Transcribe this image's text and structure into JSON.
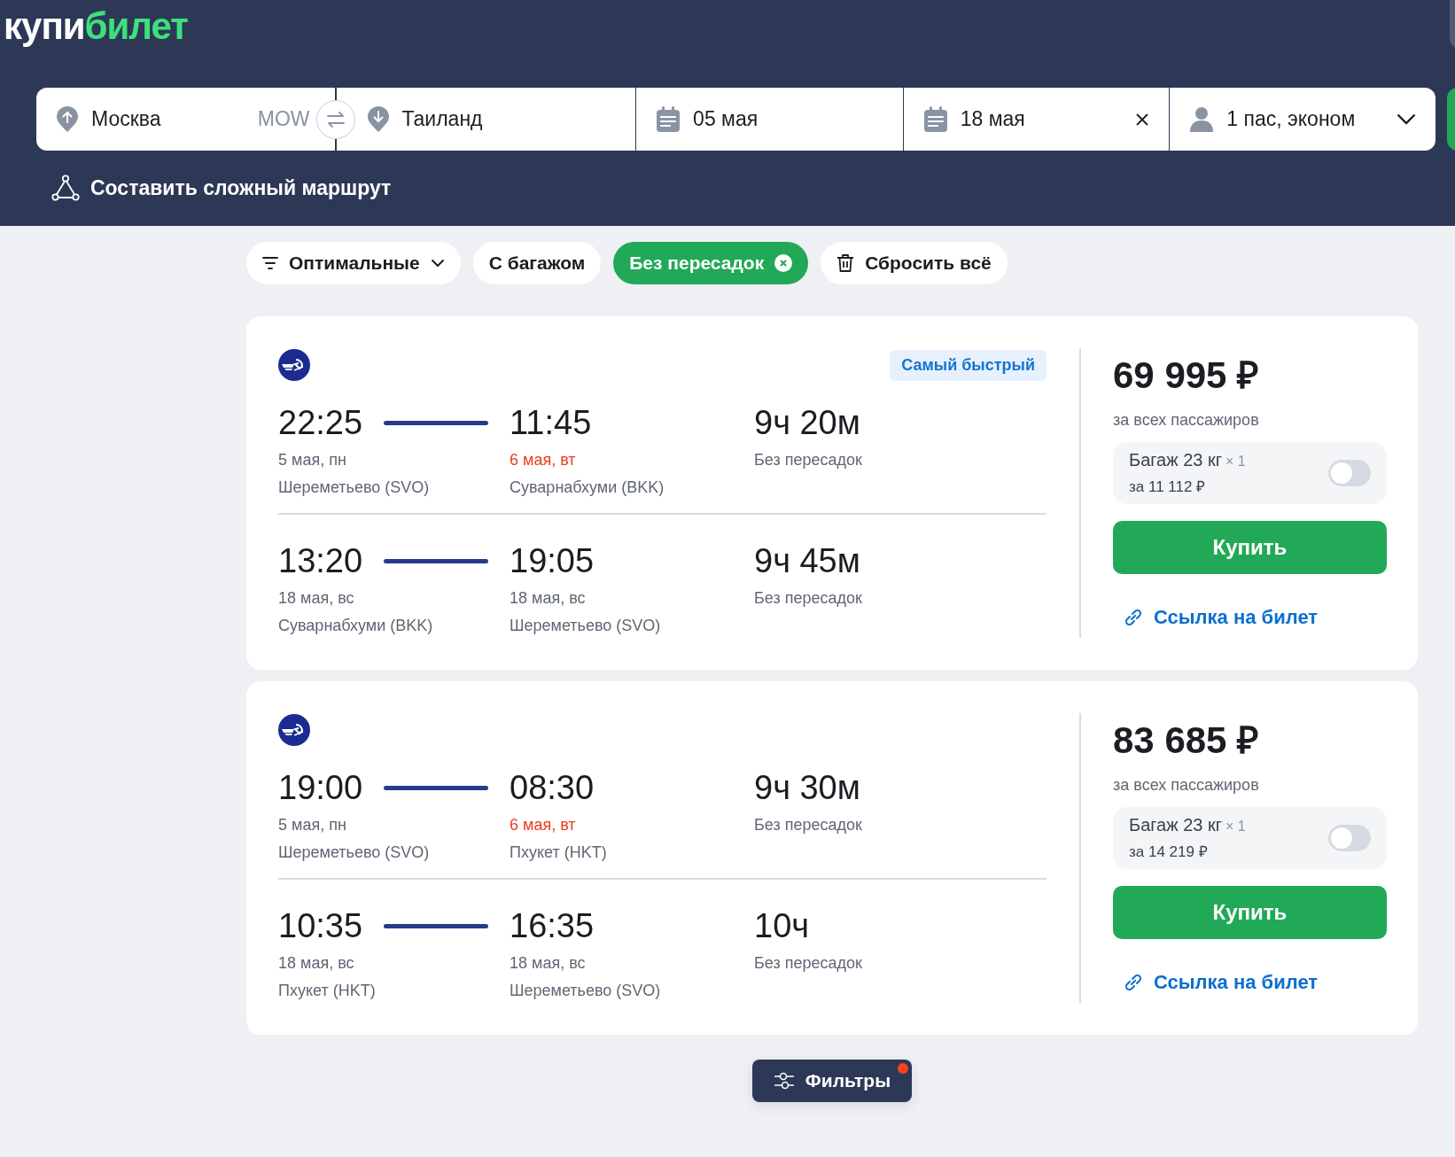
{
  "logo": {
    "first": "купи",
    "second": "билет"
  },
  "search": {
    "from": {
      "city": "Москва",
      "code": "MOW"
    },
    "to": {
      "city": "Таиланд"
    },
    "depart": "05 мая",
    "return": "18 мая",
    "passengers": "1 пас, эконом"
  },
  "complex_route": "Составить сложный маршрут",
  "chips": [
    {
      "kind": "sort",
      "label": "Оптимальные",
      "selected": false
    },
    {
      "kind": "chip",
      "label": "С багажом",
      "selected": false
    },
    {
      "kind": "chip",
      "label": "Без пересадок",
      "selected": true
    },
    {
      "kind": "reset",
      "label": "Сбросить всё",
      "selected": false
    }
  ],
  "tickets": [
    {
      "badge": "Самый быстрый",
      "price": "69 995 ₽",
      "price_note": "за всех пассажиров",
      "baggage": {
        "label": "Багаж 23 кг",
        "qty": "× 1",
        "price": "за 11 112 ₽",
        "on": false
      },
      "buy": "Купить",
      "link": "Ссылка на билет",
      "segments": [
        {
          "dep_time": "22:25",
          "dep_date": "5 мая, пн",
          "dep_airport": "Шереметьево (SVO)",
          "arr_time": "11:45",
          "arr_date": "6 мая, вт",
          "next_day": true,
          "arr_airport": "Суварнабхуми (BKK)",
          "duration": "9ч 20м",
          "stops": "Без пересадок"
        },
        {
          "dep_time": "13:20",
          "dep_date": "18 мая, вс",
          "dep_airport": "Суварнабхуми (BKK)",
          "arr_time": "19:05",
          "arr_date": "18 мая, вс",
          "next_day": false,
          "arr_airport": "Шереметьево (SVO)",
          "duration": "9ч 45м",
          "stops": "Без пересадок"
        }
      ]
    },
    {
      "price": "83 685 ₽",
      "price_note": "за всех пассажиров",
      "baggage": {
        "label": "Багаж 23 кг",
        "qty": "× 1",
        "price": "за 14 219 ₽",
        "on": false
      },
      "buy": "Купить",
      "link": "Ссылка на билет",
      "segments": [
        {
          "dep_time": "19:00",
          "dep_date": "5 мая, пн",
          "dep_airport": "Шереметьево (SVO)",
          "arr_time": "08:30",
          "arr_date": "6 мая, вт",
          "next_day": true,
          "arr_airport": "Пхукет (HKT)",
          "duration": "9ч 30м",
          "stops": "Без пересадок"
        },
        {
          "dep_time": "10:35",
          "dep_date": "18 мая, вс",
          "dep_airport": "Пхукет (HKT)",
          "arr_time": "16:35",
          "arr_date": "18 мая, вс",
          "next_day": false,
          "arr_airport": "Шереметьево (SVO)",
          "duration": "10ч",
          "stops": "Без пересадок"
        }
      ]
    }
  ],
  "filters_button": {
    "label": "Фильтры",
    "has_active": true
  }
}
